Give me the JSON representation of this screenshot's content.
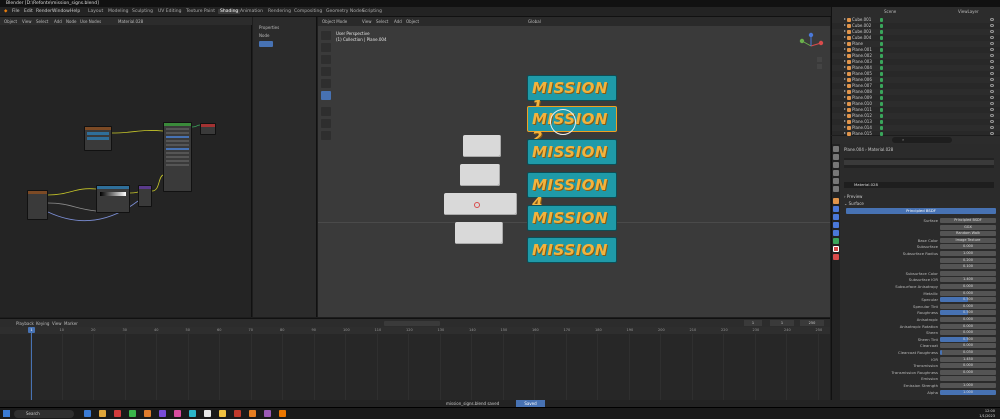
{
  "window": {
    "title": "Blender [D:\\Refonte\\mission_signs.blend]"
  },
  "top_menu": [
    "File",
    "Edit",
    "Render",
    "Window",
    "Help"
  ],
  "workspaces": [
    "Layout",
    "Modeling",
    "Sculpting",
    "UV Editing",
    "Texture Paint",
    "Shading",
    "Animation",
    "Rendering",
    "Compositing",
    "Geometry Nodes",
    "Scripting"
  ],
  "active_workspace": "Shading",
  "node_editor": {
    "header": [
      "Object",
      "View",
      "Select",
      "Add",
      "Node",
      "Use Nodes"
    ],
    "material": "Material.028"
  },
  "npanel": {
    "items": [
      "Node",
      "Options",
      "Tool",
      "View"
    ],
    "title": "Properties"
  },
  "viewport": {
    "header": [
      "Object Mode",
      "View",
      "Select",
      "Add",
      "Object"
    ],
    "info_line1": "User Perspective",
    "info_line2": "(1) Collection | Plane.004",
    "orientation": "Global",
    "signs": [
      "MISSION 1",
      "MISSION 2",
      "MISSION",
      "MISSION 4",
      "MISSION",
      "MISSION"
    ]
  },
  "outliner": {
    "search_placeholder": "Search",
    "scene": "Scene",
    "view_layer": "ViewLayer",
    "items": [
      "Cube.001",
      "Cube.002",
      "Cube.003",
      "Cube.004",
      "Plane",
      "Plane.001",
      "Plane.002",
      "Plane.003",
      "Plane.004",
      "Plane.005",
      "Plane.006",
      "Plane.007",
      "Plane.008",
      "Plane.009",
      "Plane.010",
      "Plane.011",
      "Plane.012",
      "Plane.013",
      "Plane.014",
      "Plane.015"
    ]
  },
  "properties": {
    "object": "Plane.004",
    "material": "Material.028",
    "section_preview": "Preview",
    "section_surface": "Surface",
    "surface_button": "Principled BSDF",
    "rows": [
      {
        "label": "Surface",
        "value": "Principled BSDF",
        "fill": 0
      },
      {
        "label": "",
        "value": "GGX",
        "fill": 0
      },
      {
        "label": "",
        "value": "Random Walk",
        "fill": 0
      },
      {
        "label": "Base Color",
        "value": "Image Texture",
        "fill": 0
      },
      {
        "label": "Subsurface",
        "value": "0.000",
        "fill": 0
      },
      {
        "label": "Subsurface Radius",
        "value": "1.000",
        "fill": 0
      },
      {
        "label": "",
        "value": "0.200",
        "fill": 0
      },
      {
        "label": "",
        "value": "0.100",
        "fill": 0
      },
      {
        "label": "Subsurface Color",
        "value": "",
        "fill": 0
      },
      {
        "label": "Subsurface IOR",
        "value": "1.400",
        "fill": 0
      },
      {
        "label": "Subsurface Anisotropy",
        "value": "0.000",
        "fill": 0
      },
      {
        "label": "Metallic",
        "value": "0.000",
        "fill": 0
      },
      {
        "label": "Specular",
        "value": "0.500",
        "fill": 0.5
      },
      {
        "label": "Specular Tint",
        "value": "0.000",
        "fill": 0
      },
      {
        "label": "Roughness",
        "value": "0.500",
        "fill": 0.5
      },
      {
        "label": "Anisotropic",
        "value": "0.000",
        "fill": 0
      },
      {
        "label": "Anisotropic Rotation",
        "value": "0.000",
        "fill": 0
      },
      {
        "label": "Sheen",
        "value": "0.000",
        "fill": 0
      },
      {
        "label": "Sheen Tint",
        "value": "0.500",
        "fill": 0.5
      },
      {
        "label": "Clearcoat",
        "value": "0.000",
        "fill": 0
      },
      {
        "label": "Clearcoat Roughness",
        "value": "0.030",
        "fill": 0.03
      },
      {
        "label": "IOR",
        "value": "1.450",
        "fill": 0
      },
      {
        "label": "Transmission",
        "value": "0.000",
        "fill": 0
      },
      {
        "label": "Transmission Roughness",
        "value": "0.000",
        "fill": 0
      },
      {
        "label": "Emission",
        "value": "",
        "fill": 0
      },
      {
        "label": "Emission Strength",
        "value": "1.000",
        "fill": 0
      },
      {
        "label": "Alpha",
        "value": "1.000",
        "fill": 1
      }
    ]
  },
  "timeline": {
    "menus": [
      "Playback",
      "Keying",
      "View",
      "Marker"
    ],
    "current_frame": "1",
    "ticks": [
      "0",
      "10",
      "20",
      "30",
      "40",
      "50",
      "60",
      "70",
      "80",
      "90",
      "100",
      "110",
      "120",
      "130",
      "140",
      "150",
      "160",
      "170",
      "180",
      "190",
      "200",
      "210",
      "220",
      "230",
      "240",
      "250"
    ],
    "start": "1",
    "end": "250"
  },
  "statusbar": {
    "text": "mission_signs.blend saved",
    "highlight": "Saved"
  },
  "taskbar": {
    "search": "Search",
    "clock_time": "12:00",
    "clock_date": "1/1/2023",
    "app_colors": [
      "#3a7bd5",
      "#e0a63a",
      "#d23b3b",
      "#3ab54a",
      "#e07b2c",
      "#7a4cd9",
      "#d94ca0",
      "#2bb6c9",
      "#e8e8e8",
      "#f0c040",
      "#c0392b",
      "#e67e22",
      "#9b59b6",
      "#ea7600"
    ]
  }
}
